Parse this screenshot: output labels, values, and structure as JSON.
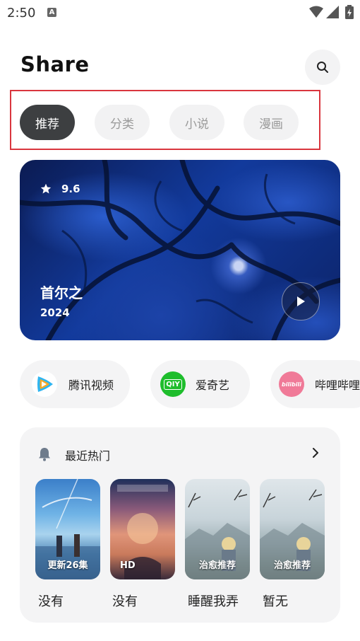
{
  "status_bar": {
    "time": "2:50",
    "notification_letter": "A"
  },
  "header": {
    "title": "Share"
  },
  "tabs": [
    {
      "label": "推荐",
      "active": true
    },
    {
      "label": "分类",
      "active": false
    },
    {
      "label": "小说",
      "active": false
    },
    {
      "label": "漫画",
      "active": false
    }
  ],
  "hero": {
    "rating": "9.6",
    "title": "首尔之",
    "year": "2024"
  },
  "platforms": [
    {
      "label": "腾讯视频",
      "logo_text": ""
    },
    {
      "label": "爱奇艺",
      "logo_text": "QIY"
    },
    {
      "label": "哔哩哔哩",
      "logo_text": "bilibili"
    }
  ],
  "recent": {
    "title": "最近热门",
    "items": [
      {
        "badge": "更新26集",
        "title": "没有"
      },
      {
        "badge": "HD",
        "title": "没有"
      },
      {
        "badge": "治愈推荐",
        "title": "睡醒我弄"
      },
      {
        "badge": "治愈推荐",
        "title": "暂无"
      }
    ]
  },
  "colors": {
    "accent_outline": "#d9363e",
    "active_tab": "#3d3f41",
    "iqiyi_green": "#1ebd2c",
    "bilibili_pink": "#f07a98"
  }
}
